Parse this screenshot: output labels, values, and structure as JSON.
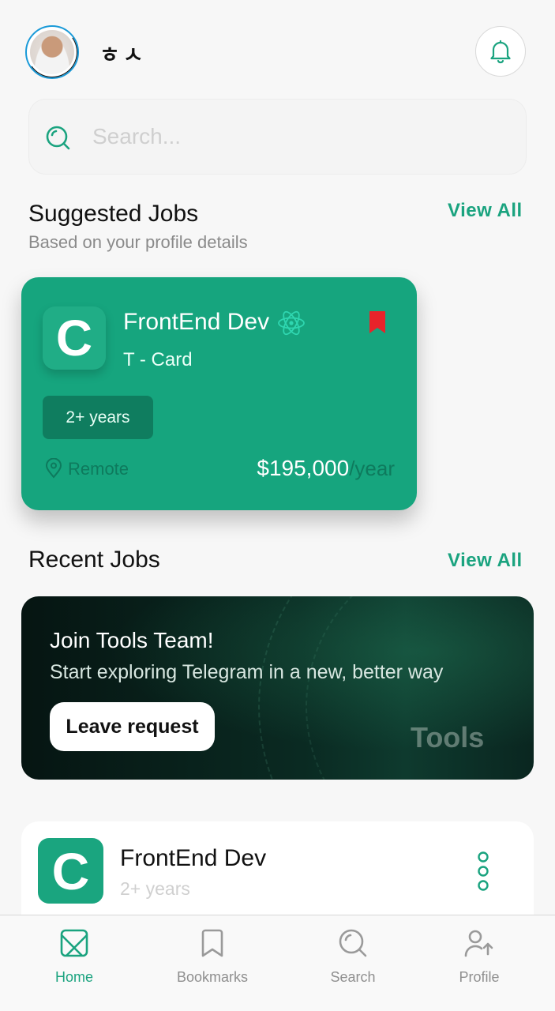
{
  "header": {
    "username": "ㅎㅅ",
    "avatar_icon": "avatar-photo",
    "notification_icon": "bell-icon"
  },
  "search": {
    "placeholder": "Search...",
    "value": ""
  },
  "suggested": {
    "title": "Suggested Jobs",
    "subtitle": "Based on your profile details",
    "view_all": "View All",
    "job": {
      "logo_letter": "C",
      "title": "FrontEnd Dev",
      "tech_icon": "react-atom-icon",
      "company": "T - Card",
      "experience": "2+ years",
      "location": "Remote",
      "salary": "$195,000",
      "salary_period": "/year",
      "bookmarked": true
    }
  },
  "recent": {
    "title": "Recent Jobs",
    "view_all": "View All",
    "banner": {
      "title": "Join Tools Team!",
      "subtitle": "Start exploring Telegram in a new, better way",
      "button": "Leave request",
      "brand": "Tools"
    },
    "jobs": [
      {
        "logo_letter": "C",
        "title": "FrontEnd Dev",
        "experience": "2+ years"
      }
    ]
  },
  "nav": {
    "items": [
      {
        "label": "Home",
        "icon": "home-icon",
        "active": true
      },
      {
        "label": "Bookmarks",
        "icon": "bookmark-icon",
        "active": false
      },
      {
        "label": "Search",
        "icon": "search-icon",
        "active": false
      },
      {
        "label": "Profile",
        "icon": "profile-icon",
        "active": false
      }
    ]
  },
  "colors": {
    "accent": "#16a57e",
    "background": "#f7f7f7",
    "bookmark": "#e8232a",
    "banner_dark": "#0a2a22"
  }
}
